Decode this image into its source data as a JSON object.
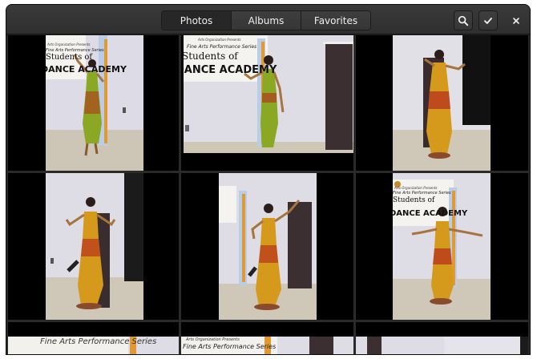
{
  "header": {
    "tabs": [
      {
        "label": "Photos",
        "active": true
      },
      {
        "label": "Albums",
        "active": false
      },
      {
        "label": "Favorites",
        "active": false
      }
    ],
    "buttons": {
      "search_icon": "search-icon",
      "select_icon": "checkmark-icon",
      "close_icon": "close-icon"
    }
  },
  "banner": {
    "line_small": "Arts Organization Presents",
    "line_series": "Fine Arts Performance Series",
    "line_students": "Students of",
    "line_academy": "DANCE ACADEMY"
  },
  "colors": {
    "headerbar": "#353535",
    "grid_bg": "#2a2a2a",
    "wall": "#dcdbe4",
    "floor": "#cfc7b8",
    "costume_green": "#8aa823",
    "costume_gold": "#d59a1b",
    "costume_red": "#b52a1c"
  }
}
